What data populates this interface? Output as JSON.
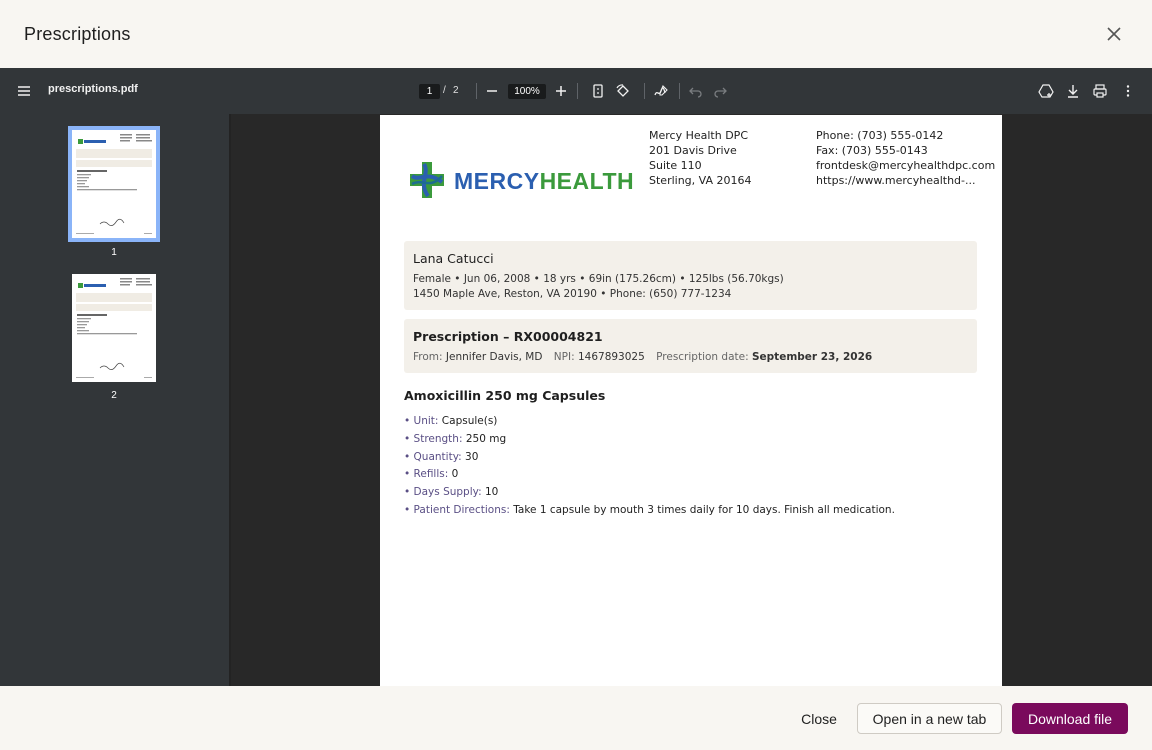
{
  "modal": {
    "title": "Prescriptions"
  },
  "viewer": {
    "filename": "prescriptions.pdf",
    "current_page": "1",
    "page_sep": "/",
    "total_pages": "2",
    "zoom": "100%"
  },
  "thumbnails": [
    {
      "label": "1"
    },
    {
      "label": "2"
    }
  ],
  "document": {
    "logo": {
      "part1": "MERCY",
      "part2": "HEALTH",
      "color1": "#2b5fb0",
      "color2": "#3b9a3c"
    },
    "clinic": {
      "line1": "Mercy Health DPC",
      "line2": "201 Davis Drive",
      "line3": "Suite 110",
      "line4": "Sterling, VA 20164"
    },
    "contact": {
      "phone": "Phone: (703) 555-0142",
      "fax": "Fax: (703) 555-0143",
      "email": "frontdesk@mercyhealthdpc.com",
      "web": "https://www.mercyhealthd-..."
    },
    "patient": {
      "name": "Lana Catucci",
      "line1": "Female • Jun 06, 2008 • 18 yrs • 69in (175.26cm) • 125lbs (56.70kgs)",
      "line2": "1450 Maple Ave, Reston, VA 20190 • Phone: (650) 777-1234"
    },
    "prescription": {
      "title": "Prescription – RX00004821",
      "from_label": "From:",
      "from_value": "Jennifer Davis, MD",
      "npi_label": "NPI:",
      "npi_value": "1467893025",
      "date_label": "Prescription date:",
      "date_value": "September 23, 2026"
    },
    "medication": {
      "title": "Amoxicillin 250 mg Capsules",
      "details": [
        {
          "label": "• Unit:",
          "value": "Capsule(s)"
        },
        {
          "label": "• Strength:",
          "value": "250 mg"
        },
        {
          "label": "• Quantity:",
          "value": "30"
        },
        {
          "label": "• Refills:",
          "value": "0"
        },
        {
          "label": "• Days Supply:",
          "value": "10"
        },
        {
          "label": "• Patient Directions:",
          "value": "Take 1 capsule by mouth 3 times daily for 10 days. Finish all medication."
        }
      ]
    }
  },
  "footer": {
    "close_label": "Close",
    "open_tab_label": "Open in a new tab",
    "download_label": "Download file",
    "primary_color": "#7a0a5c"
  }
}
